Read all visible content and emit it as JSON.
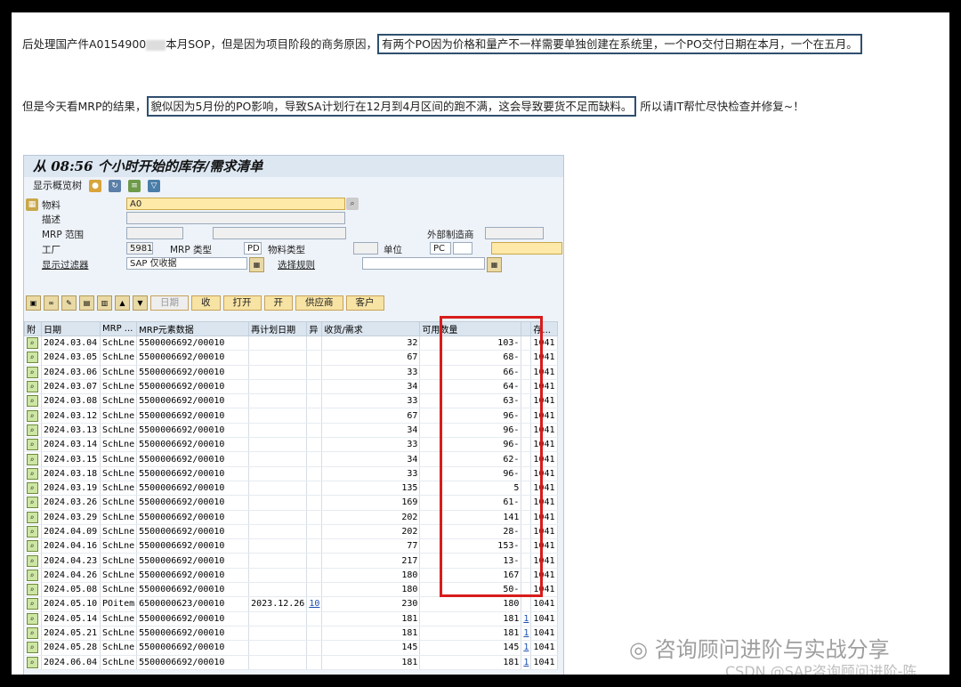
{
  "paragraph1": {
    "before_blur": "后处理国产件A0154900",
    "after_blur": "本月SOP，但是因为项目阶段的商务原因，",
    "highlight": "有两个PO因为价格和量产不一样需要单独创建在系统里，一个PO交付日期在本月，一个在五月。"
  },
  "paragraph2": {
    "before": "但是今天看MRP的结果，",
    "highlight": "貌似因为5月份的PO影响，导致SA计划行在12月到4月区间的跑不满，这会导致要货不足而缺料。",
    "after": "所以请IT帮忙尽快检查并修复~！"
  },
  "sap": {
    "title": "从 08:56 个小时开始的库存/需求清单",
    "menu_label": "显示概览树",
    "fields": {
      "material_label": "物料",
      "material_value": "A0",
      "desc_label": "描述",
      "mrp_area_label": "MRP 范围",
      "ext_mfr_label": "外部制造商",
      "plant_label": "工厂",
      "plant_value": "5981",
      "mrp_type_label": "MRP 类型",
      "mrp_type_value": "PD",
      "mat_type_label": "物料类型",
      "unit_label": "单位",
      "unit_value": "PC",
      "filter_label": "显示过滤器",
      "filter_value": "SAP 仅收据",
      "rule_label": "选择规则"
    },
    "buttons": {
      "date": "日期",
      "receive": "收",
      "open": "打开",
      "open2": "开",
      "supplier": "供应商",
      "customer": "客户"
    },
    "columns": [
      "附",
      "日期",
      "MRP ...",
      "MRP元素数据",
      "再计划日期",
      "异",
      "收货/需求",
      "可用数量",
      "",
      "存..."
    ],
    "rows": [
      [
        "2024.03.04",
        "SchLne",
        "5500006692/00010",
        "",
        "",
        "32",
        "103-",
        "",
        "1041"
      ],
      [
        "2024.03.05",
        "SchLne",
        "5500006692/00010",
        "",
        "",
        "67",
        "68-",
        "",
        "1041"
      ],
      [
        "2024.03.06",
        "SchLne",
        "5500006692/00010",
        "",
        "",
        "33",
        "66-",
        "",
        "1041"
      ],
      [
        "2024.03.07",
        "SchLne",
        "5500006692/00010",
        "",
        "",
        "34",
        "64-",
        "",
        "1041"
      ],
      [
        "2024.03.08",
        "SchLne",
        "5500006692/00010",
        "",
        "",
        "33",
        "63-",
        "",
        "1041"
      ],
      [
        "2024.03.12",
        "SchLne",
        "5500006692/00010",
        "",
        "",
        "67",
        "96-",
        "",
        "1041"
      ],
      [
        "2024.03.13",
        "SchLne",
        "5500006692/00010",
        "",
        "",
        "34",
        "96-",
        "",
        "1041"
      ],
      [
        "2024.03.14",
        "SchLne",
        "5500006692/00010",
        "",
        "",
        "33",
        "96-",
        "",
        "1041"
      ],
      [
        "2024.03.15",
        "SchLne",
        "5500006692/00010",
        "",
        "",
        "34",
        "62-",
        "",
        "1041"
      ],
      [
        "2024.03.18",
        "SchLne",
        "5500006692/00010",
        "",
        "",
        "33",
        "96-",
        "",
        "1041"
      ],
      [
        "2024.03.19",
        "SchLne",
        "5500006692/00010",
        "",
        "",
        "135",
        "5",
        "",
        "1041"
      ],
      [
        "2024.03.26",
        "SchLne",
        "5500006692/00010",
        "",
        "",
        "169",
        "61-",
        "",
        "1041"
      ],
      [
        "2024.03.29",
        "SchLne",
        "5500006692/00010",
        "",
        "",
        "202",
        "141",
        "",
        "1041"
      ],
      [
        "2024.04.09",
        "SchLne",
        "5500006692/00010",
        "",
        "",
        "202",
        "28-",
        "",
        "1041"
      ],
      [
        "2024.04.16",
        "SchLne",
        "5500006692/00010",
        "",
        "",
        "77",
        "153-",
        "",
        "1041"
      ],
      [
        "2024.04.23",
        "SchLne",
        "5500006692/00010",
        "",
        "",
        "217",
        "13-",
        "",
        "1041"
      ],
      [
        "2024.04.26",
        "SchLne",
        "5500006692/00010",
        "",
        "",
        "180",
        "167",
        "",
        "1041"
      ],
      [
        "2024.05.08",
        "SchLne",
        "5500006692/00010",
        "",
        "",
        "180",
        "50-",
        "",
        "1041"
      ],
      [
        "2024.05.10",
        "POitem",
        "6500000623/00010",
        "2023.12.26",
        "10",
        "230",
        "180",
        "",
        "1041"
      ],
      [
        "2024.05.14",
        "SchLne",
        "5500006692/00010",
        "",
        "",
        "181",
        "181",
        "1",
        "1041"
      ],
      [
        "2024.05.21",
        "SchLne",
        "5500006692/00010",
        "",
        "",
        "181",
        "181",
        "1",
        "1041"
      ],
      [
        "2024.05.28",
        "SchLne",
        "5500006692/00010",
        "",
        "",
        "145",
        "145",
        "1",
        "1041"
      ],
      [
        "2024.06.04",
        "SchLne",
        "5500006692/00010",
        "",
        "",
        "181",
        "181",
        "1",
        "1041"
      ]
    ]
  },
  "watermarks": {
    "wechat": "咨询顾问进阶与实战分享",
    "csdn": "CSDN @SAP咨询顾问进阶-陈"
  }
}
